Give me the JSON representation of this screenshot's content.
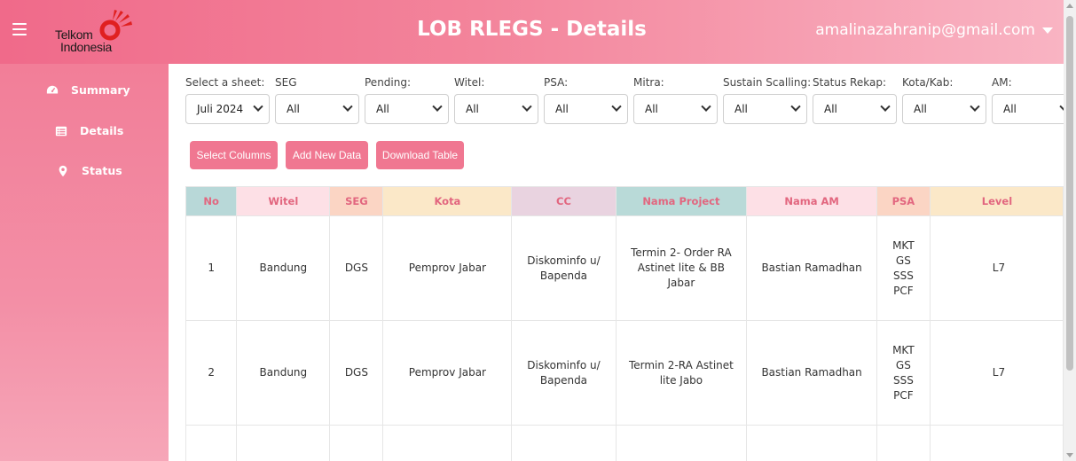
{
  "header": {
    "title": "LOB RLEGS - Details",
    "user_email": "amalinazahranip@gmail.com",
    "logo_line1": "Telkom",
    "logo_line2": "Indonesia"
  },
  "sidebar": {
    "items": [
      {
        "label": "Summary",
        "icon": "dashboard-icon"
      },
      {
        "label": "Details",
        "icon": "list-icon"
      },
      {
        "label": "Status",
        "icon": "location-pin-icon"
      }
    ]
  },
  "filters": [
    {
      "label": "Select a sheet:",
      "value": "Juli 2024"
    },
    {
      "label": "SEG",
      "value": "All"
    },
    {
      "label": "Pending:",
      "value": "All"
    },
    {
      "label": "Witel:",
      "value": "All"
    },
    {
      "label": "PSA:",
      "value": "All"
    },
    {
      "label": "Mitra:",
      "value": "All"
    },
    {
      "label": "Sustain Scalling:",
      "value": "All"
    },
    {
      "label": "Status Rekap:",
      "value": "All"
    },
    {
      "label": "Kota/Kab:",
      "value": "All"
    },
    {
      "label": "AM:",
      "value": "All"
    }
  ],
  "buttons": {
    "select_columns": "Select Columns",
    "add_new_data": "Add New Data",
    "download_table": "Download Table"
  },
  "table": {
    "headers": [
      "No",
      "Witel",
      "SEG",
      "Kota",
      "CC",
      "Nama Project",
      "Nama AM",
      "PSA",
      "Level"
    ],
    "header_colors": [
      "#b8d8d8",
      "#fde0e6",
      "#fbd5c4",
      "#fbe8c8",
      "#e9d3e0",
      "#b9dad8",
      "#fde0e6",
      "#fbd5c4",
      "#fbe8c8"
    ],
    "rows": [
      [
        "1",
        "Bandung",
        "DGS",
        "Pemprov Jabar",
        "Diskominfo u/ Bapenda",
        "Termin 2- Order RA Astinet lite & BB Jabar",
        "Bastian Ramadhan",
        "MKT GS SSS PCF",
        "L7"
      ],
      [
        "2",
        "Bandung",
        "DGS",
        "Pemprov Jabar",
        "Diskominfo u/ Bapenda",
        "Termin 2-RA Astinet lite Jabo",
        "Bastian Ramadhan",
        "MKT GS SSS PCF",
        "L7"
      ]
    ]
  },
  "colors": {
    "accent": "#f07791",
    "header_gradient_start": "#f06a8a",
    "header_gradient_end": "#f9b4c3"
  }
}
